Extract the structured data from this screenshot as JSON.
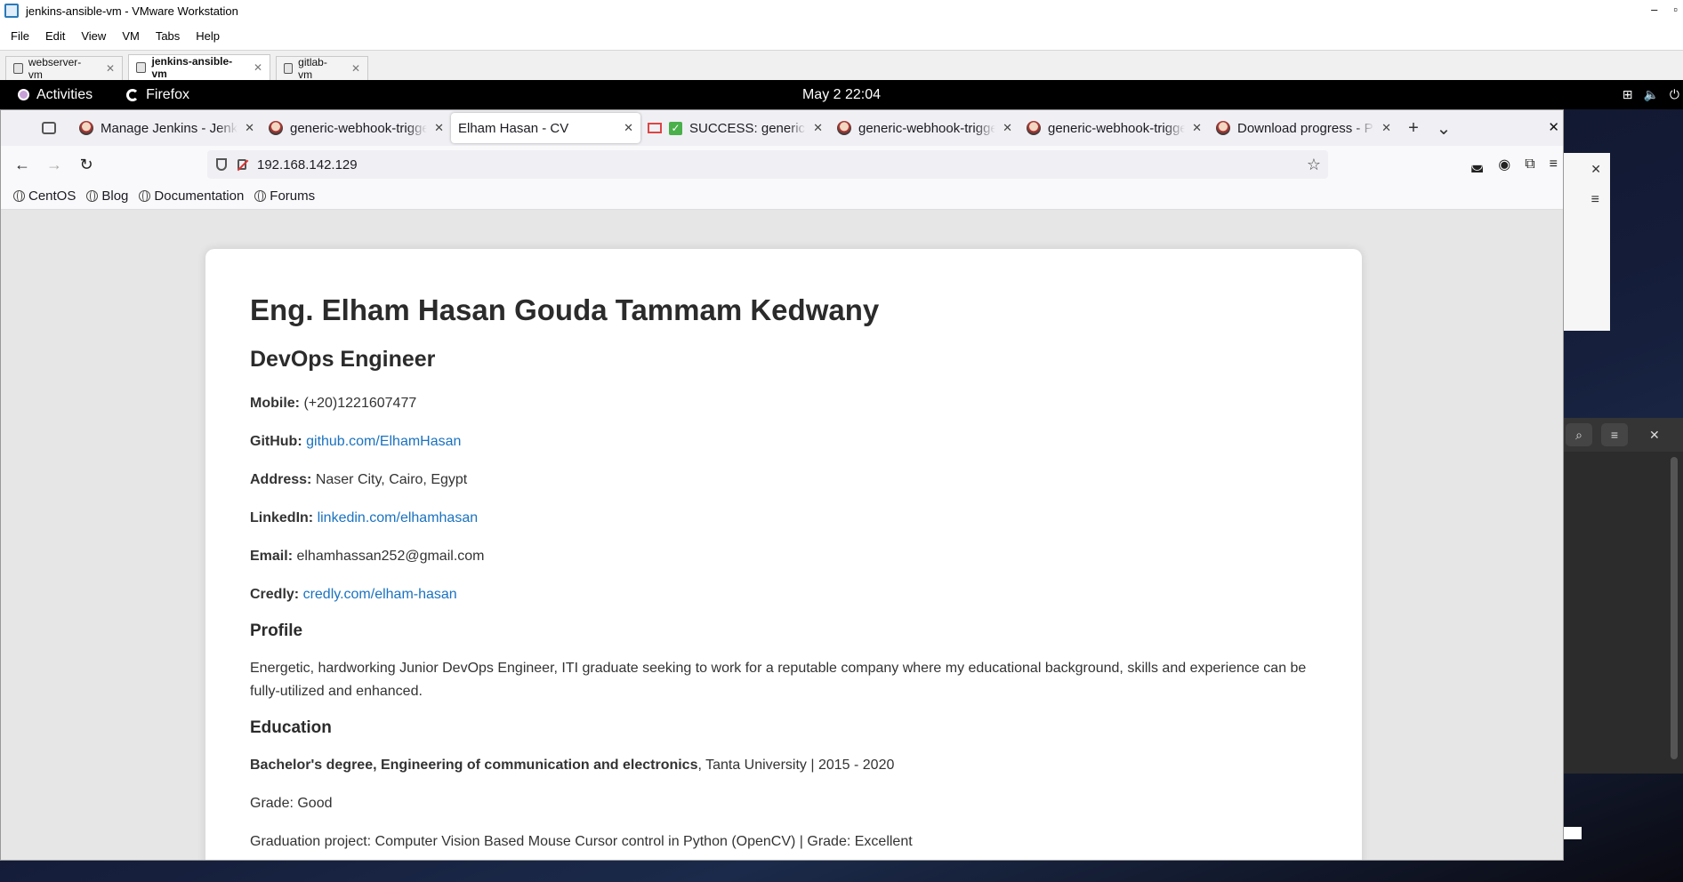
{
  "vm": {
    "title": "jenkins-ansible-vm - VMware Workstation",
    "menu": [
      "File",
      "Edit",
      "View",
      "VM",
      "Tabs",
      "Help"
    ],
    "tabs": [
      {
        "label": "webserver-vm"
      },
      {
        "label": "jenkins-ansible-vm"
      },
      {
        "label": "gitlab-vm"
      }
    ]
  },
  "gnome": {
    "activities": "Activities",
    "app": "Firefox",
    "clock": "May 2  22:04"
  },
  "firefox": {
    "tabs": [
      {
        "label": "Manage Jenkins - Jenkins",
        "icon": "jenkins-favicon"
      },
      {
        "label": "generic-webhook-trigger",
        "icon": "jenkins-favicon"
      },
      {
        "label": "Elham Hasan - CV",
        "icon": "none"
      },
      {
        "label": "SUCCESS: generic-webhook",
        "icon": "gmail-favicon"
      },
      {
        "label": "generic-webhook-trigger",
        "icon": "jenkins-favicon"
      },
      {
        "label": "generic-webhook-trigger",
        "icon": "jenkins-favicon"
      },
      {
        "label": "Download progress - Plugins",
        "icon": "jenkins-favicon"
      }
    ],
    "url": "192.168.142.129",
    "bookmarks": [
      "CentOS",
      "Blog",
      "Documentation",
      "Forums"
    ]
  },
  "cv": {
    "name": "Eng. Elham Hasan Gouda Tammam Kedwany",
    "role": "DevOps Engineer",
    "mobile_label": "Mobile:",
    "mobile": "(+20)1221607477",
    "github_label": "GitHub:",
    "github": "github.com/ElhamHasan",
    "address_label": "Address:",
    "address": "Naser City, Cairo, Egypt",
    "linkedin_label": "LinkedIn:",
    "linkedin": "linkedin.com/elhamhasan",
    "email_label": "Email:",
    "email": "elhamhassan252@gmail.com",
    "credly_label": "Credly:",
    "credly": "credly.com/elham-hasan",
    "profile_heading": "Profile",
    "profile_text": "Energetic, hardworking Junior DevOps Engineer, ITI graduate seeking to work for a reputable company where my educational background, skills and experience can be fully-utilized and enhanced.",
    "education_heading": "Education",
    "degree": "Bachelor's degree, Engineering of communication and electronics",
    "university": ", Tanta University | 2015 - 2020",
    "grade": "Grade: Good",
    "project": "Graduation project: Computer Vision Based Mouse Cursor control in Python (OpenCV) | Grade: Excellent"
  }
}
